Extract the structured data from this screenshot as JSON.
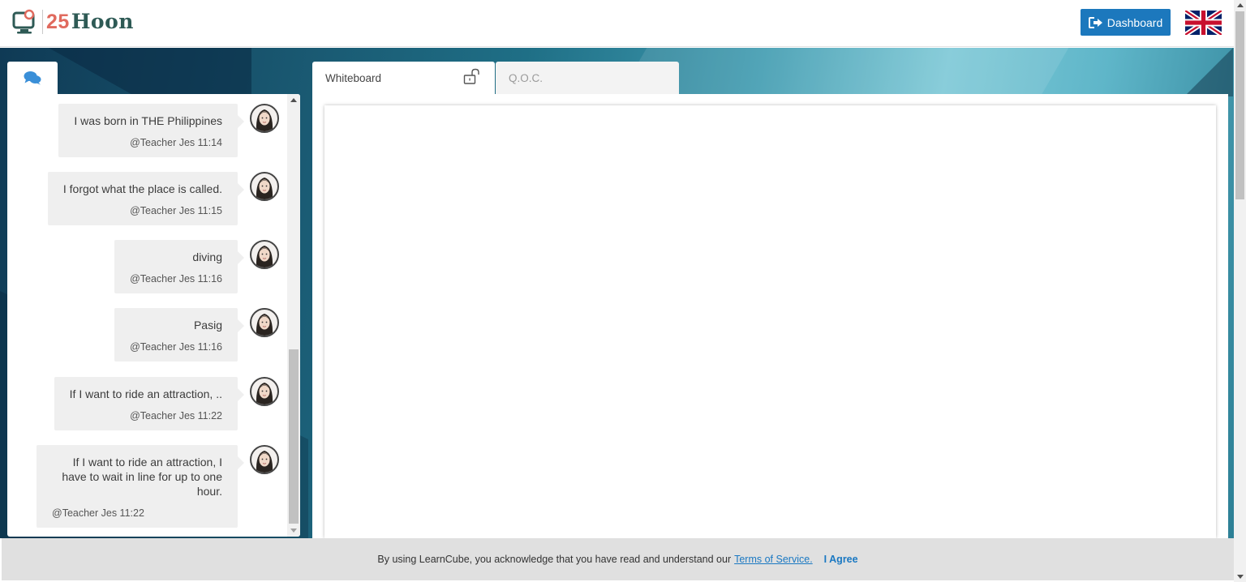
{
  "header": {
    "logo_number": "25",
    "logo_text": "Hoon",
    "dashboard_label": "Dashboard",
    "language_flag": "uk-flag-icon"
  },
  "chat": {
    "tab_icon": "chat-bubbles-icon",
    "messages": [
      {
        "text": "I was born in THE Philippines",
        "meta": "@Teacher Jes 11:14"
      },
      {
        "text": "I forgot what the place is called.",
        "meta": "@Teacher Jes 11:15"
      },
      {
        "text": "diving",
        "meta": "@Teacher Jes 11:16"
      },
      {
        "text": "Pasig",
        "meta": "@Teacher Jes 11:16"
      },
      {
        "text": "If I want to ride an attraction, ..",
        "meta": "@Teacher Jes 11:22"
      },
      {
        "text": "If I want to ride an attraction, I have to wait in line for up to one hour.",
        "meta": "@Teacher Jes 11:22"
      }
    ]
  },
  "tabs": {
    "whiteboard": "Whiteboard",
    "qoc": "Q.O.C."
  },
  "cookie": {
    "text": "By using LearnCube, you acknowledge that you have read and understand our",
    "link": "Terms of Service.",
    "agree": "I Agree"
  },
  "colors": {
    "accent": "#1c78bd",
    "logo_coral": "#e06a5e",
    "logo_teal": "#2e5a55"
  }
}
